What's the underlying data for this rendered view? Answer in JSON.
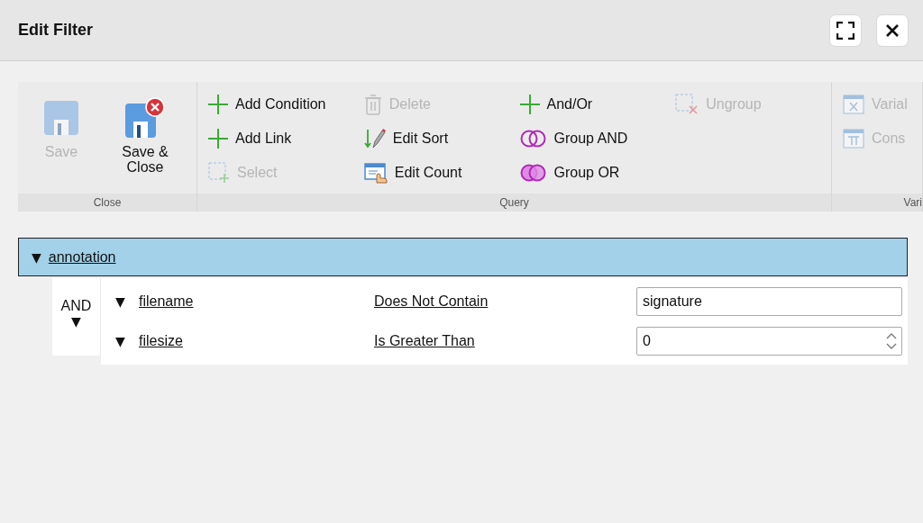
{
  "window": {
    "title": "Edit Filter"
  },
  "ribbon": {
    "groups": [
      {
        "label": "Close",
        "columns": [
          [
            {
              "label": "Save",
              "kind": "save",
              "disabled": true
            }
          ],
          [
            {
              "label": "Save & Close",
              "kind": "save-close",
              "disabled": false
            }
          ]
        ]
      },
      {
        "label": "Query",
        "columns": [
          [
            {
              "label": "Add Condition",
              "kind": "add",
              "disabled": false
            },
            {
              "label": "Add Link",
              "kind": "add",
              "disabled": false
            },
            {
              "label": "Select",
              "kind": "select",
              "disabled": true
            }
          ],
          [
            {
              "label": "Delete",
              "kind": "delete",
              "disabled": true
            },
            {
              "label": "Edit Sort",
              "kind": "sort",
              "disabled": false
            },
            {
              "label": "Edit Count",
              "kind": "count",
              "disabled": false
            }
          ],
          [
            {
              "label": "And/Or",
              "kind": "add",
              "disabled": false
            },
            {
              "label": "Group AND",
              "kind": "group-and",
              "disabled": false
            },
            {
              "label": "Group OR",
              "kind": "group-or",
              "disabled": false
            }
          ],
          [
            {
              "label": "Ungroup",
              "kind": "ungroup",
              "disabled": true
            }
          ]
        ]
      },
      {
        "label": "Vari",
        "columns": [
          [
            {
              "label": "Varial",
              "kind": "variable",
              "disabled": true
            },
            {
              "label": "Cons",
              "kind": "constant",
              "disabled": true
            }
          ]
        ]
      }
    ]
  },
  "filter": {
    "toggle": "▼",
    "entity": "annotation",
    "expanded": true,
    "logic": {
      "label": "AND",
      "toggle": "▼"
    },
    "conditions": [
      {
        "toggle": "▼",
        "field": "filename",
        "operator": "Does Not Contain",
        "value": "signature",
        "kind": "text"
      },
      {
        "toggle": "▼",
        "field": "filesize",
        "operator": "Is Greater Than",
        "value": "0",
        "kind": "number"
      }
    ]
  }
}
